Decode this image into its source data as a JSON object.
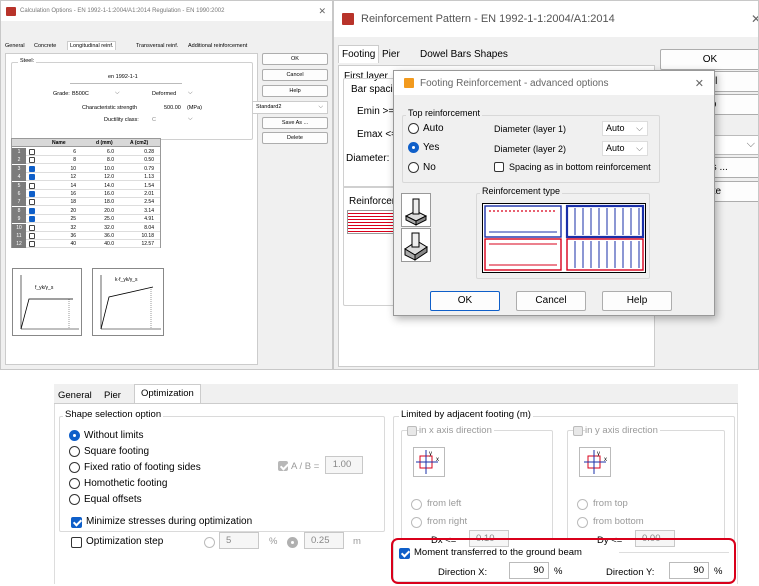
{
  "calc": {
    "title": "Calculation Options - EN 1992-1-1:2004/A1:2014  Regulation - EN 1990:2002",
    "tabs": [
      "General",
      "Concrete",
      "Longitudinal reinf.",
      "Transversal reinf.",
      "Additional reinforcement"
    ],
    "steel_legend": "Steel:",
    "code": "en 1992-1-1",
    "grade_label": "Grade:",
    "grade_value": "B500C",
    "bar_type": "Deformed",
    "char_strength_label": "Characteristic strength",
    "char_strength_value": "500.00",
    "char_strength_unit": "(MPa)",
    "ductility_label": "Ductility class:",
    "ductility_value": "C",
    "buttons": {
      "ok": "OK",
      "cancel": "Cancel",
      "help": "Help",
      "save_as": "Save As ...",
      "delete": "Delete"
    },
    "preset": "Standard2",
    "table": {
      "headers": [
        "Name",
        "d (mm)",
        "A (cm2)"
      ],
      "rows": [
        {
          "n": "1",
          "checked": false,
          "name": "6",
          "d": "6.0",
          "a": "0.28"
        },
        {
          "n": "2",
          "checked": false,
          "name": "8",
          "d": "8.0",
          "a": "0.50"
        },
        {
          "n": "3",
          "checked": true,
          "name": "10",
          "d": "10.0",
          "a": "0.79"
        },
        {
          "n": "4",
          "checked": true,
          "name": "12",
          "d": "12.0",
          "a": "1.13"
        },
        {
          "n": "5",
          "checked": false,
          "name": "14",
          "d": "14.0",
          "a": "1.54"
        },
        {
          "n": "6",
          "checked": true,
          "name": "16",
          "d": "16.0",
          "a": "2.01"
        },
        {
          "n": "7",
          "checked": false,
          "name": "18",
          "d": "18.0",
          "a": "2.54"
        },
        {
          "n": "8",
          "checked": true,
          "name": "20",
          "d": "20.0",
          "a": "3.14"
        },
        {
          "n": "9",
          "checked": true,
          "name": "25",
          "d": "25.0",
          "a": "4.91"
        },
        {
          "n": "10",
          "checked": false,
          "name": "32",
          "d": "32.0",
          "a": "8.04"
        },
        {
          "n": "11",
          "checked": false,
          "name": "36",
          "d": "36.0",
          "a": "10.18"
        },
        {
          "n": "12",
          "checked": false,
          "name": "40",
          "d": "40.0",
          "a": "12.57"
        }
      ]
    },
    "diagram1_label": "f_yk/γ_s",
    "diagram2_label": "k·f_yk/γ_s"
  },
  "pattern": {
    "title": "Reinforcement Pattern - EN 1992-1-1:2004/A1:2014",
    "tabs": [
      "Footing",
      "Pier",
      "Dowel Bars",
      "Shapes"
    ],
    "first_layer": "First layer",
    "bar_spacing": "Bar spaci",
    "emin": "Emin >=",
    "emax": "Emax <=",
    "diameter": "Diameter:",
    "reinforcement": "Reinforcem",
    "buttons": {
      "ok": "OK",
      "cancel": "ncel",
      "help": "elp",
      "save_as": "As ...",
      "delete": "lete"
    }
  },
  "advanced": {
    "title": "Footing Reinforcement - advanced options",
    "top_reinforcement": "Top reinforcement",
    "options": [
      "Auto",
      "Yes",
      "No"
    ],
    "selected": "Yes",
    "diam1_label": "Diameter (layer 1)",
    "diam1_value": "Auto",
    "diam2_label": "Diameter (layer 2)",
    "diam2_value": "Auto",
    "spacing_label": "Spacing as in bottom reinforcement",
    "reinf_type": "Reinforcement type",
    "buttons": {
      "ok": "OK",
      "cancel": "Cancel",
      "help": "Help"
    }
  },
  "opt": {
    "tabs": [
      "General",
      "Pier",
      "Optimization"
    ],
    "shape_legend": "Shape selection option",
    "shapes": [
      "Without limits",
      "Square footing",
      "Fixed ratio of footing sides",
      "Homothetic footing",
      "Equal offsets"
    ],
    "selected_shape": "Without limits",
    "ratio_label": "A / B =",
    "ratio_value": "1.00",
    "minimize_label": "Minimize stresses during optimization",
    "minimize_checked": true,
    "step_label": "Optimization step",
    "step_value": "5",
    "step_unit": "%",
    "step_value2": "0.25",
    "step_unit2": "m",
    "limited_legend": "Limited by adjacent footing (m)",
    "x_dir": "in x axis direction",
    "y_dir": "in y axis direction",
    "from_left": "from left",
    "from_right": "from right",
    "from_top": "from top",
    "from_bottom": "from bottom",
    "dx_label": "Dx <=",
    "dx_value": "0.10",
    "dy_label": "Dy <=",
    "dy_value": "0.00",
    "moment_label": "Moment transferred to the ground beam",
    "moment_checked": true,
    "dir_x_label": "Direction X:",
    "dir_x_value": "90",
    "dir_y_label": "Direction Y:",
    "dir_y_value": "90",
    "pct": "%",
    "highlight_color": "#d9001b"
  }
}
